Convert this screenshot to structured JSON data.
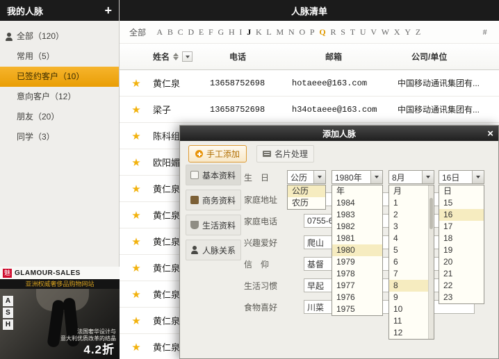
{
  "colors": {
    "header_dark": "#1b1b1b",
    "accent_orange": "#efa30a",
    "star_gold": "#f2b20e",
    "dropdown_highlight": "#f6ecc0",
    "alphabet_highlight": "#e09a00"
  },
  "icons": {
    "star": "★"
  },
  "sidebar": {
    "title": "我的人脉",
    "add_button": "+",
    "items": [
      {
        "label": "全部（120）",
        "selected": false,
        "has_icon": true
      },
      {
        "label": "常用（5）",
        "selected": false
      },
      {
        "label": "已签约客户（10）",
        "selected": true
      },
      {
        "label": "意向客户（12）",
        "selected": false
      },
      {
        "label": "朋友（20）",
        "selected": false
      },
      {
        "label": "同学（3）",
        "selected": false
      }
    ],
    "ad": {
      "logo_text": "魅",
      "brand": "GLAMOUR-SALES",
      "subtitle": "亚洲权威奢侈品购物网站",
      "vertical_letters": [
        "A",
        "S",
        "H"
      ],
      "caption_line1": "法国奢华设计与",
      "caption_line2": "意大利优质改革的结晶",
      "discount": "4.2折"
    }
  },
  "main": {
    "title": "人脉清单",
    "alphabet": {
      "all_label": "全部",
      "letters": [
        "A",
        "B",
        "C",
        "D",
        "E",
        "F",
        "G",
        "H",
        "I",
        "J",
        "K",
        "L",
        "M",
        "N",
        "O",
        "P",
        "Q",
        "R",
        "S",
        "T",
        "U",
        "V",
        "W",
        "X",
        "Y",
        "Z"
      ],
      "hash": "#",
      "bold_letter": "J",
      "highlighted_letter": "Q"
    },
    "table": {
      "headers": {
        "name": "姓名",
        "phone": "电话",
        "email": "邮箱",
        "company": "公司/单位"
      },
      "rows": [
        {
          "name": "黄仁泉",
          "phone": "13658752698",
          "email": "hotaeee@163.com",
          "company": "中国移动通讯集团有..."
        },
        {
          "name": "梁子",
          "phone": "13658752698",
          "email": "h34otaeee@163.com",
          "company": "中国移动通讯集团有..."
        },
        {
          "name": "陈科组"
        },
        {
          "name": "欧阳媚"
        },
        {
          "name": "黄仁泉"
        },
        {
          "name": "黄仁泉"
        },
        {
          "name": "黄仁泉"
        },
        {
          "name": "黄仁泉"
        },
        {
          "name": "黄仁泉"
        },
        {
          "name": "黄仁泉"
        },
        {
          "name": "黄仁泉"
        }
      ]
    }
  },
  "modal": {
    "title": "添加人脉",
    "close_label": "×",
    "toolbar": {
      "manual_add": "手工添加",
      "card_process": "名片处理"
    },
    "tabs": [
      {
        "label": "基本资料",
        "icon": "doc-icon"
      },
      {
        "label": "商务资料",
        "icon": "briefcase-icon"
      },
      {
        "label": "生活资料",
        "icon": "cup-icon"
      },
      {
        "label": "人脉关系",
        "icon": "person-icon"
      }
    ],
    "form": {
      "birthday_label": "生　日",
      "calendar": {
        "value": "公历",
        "selected": "公历",
        "options": [
          "公历",
          "农历"
        ]
      },
      "year": {
        "value": "1980年",
        "selected": "1980",
        "options": [
          "年",
          "1984",
          "1983",
          "1982",
          "1981",
          "1980",
          "1979",
          "1978",
          "1977",
          "1976",
          "1975"
        ]
      },
      "month": {
        "value": "8月",
        "selected": "8",
        "options": [
          "月",
          "1",
          "2",
          "3",
          "4",
          "5",
          "6",
          "7",
          "8",
          "9",
          "10",
          "11",
          "12"
        ]
      },
      "day": {
        "value": "16日",
        "selected": "16",
        "options": [
          "日",
          "15",
          "16",
          "17",
          "18",
          "19",
          "20",
          "21",
          "22",
          "23"
        ]
      },
      "fields": [
        {
          "id": "home-address",
          "label": "家庭地址",
          "value": ""
        },
        {
          "id": "home-phone",
          "label": "家庭电话",
          "value": "0755-63325512"
        },
        {
          "id": "hobby",
          "label": "兴趣爱好",
          "value": "爬山"
        },
        {
          "id": "faith",
          "label": "信　仰",
          "value": "基督"
        },
        {
          "id": "living-habit",
          "label": "生活习惯",
          "value": "早起"
        },
        {
          "id": "food-preference",
          "label": "食物喜好",
          "value": "川菜"
        }
      ]
    }
  }
}
